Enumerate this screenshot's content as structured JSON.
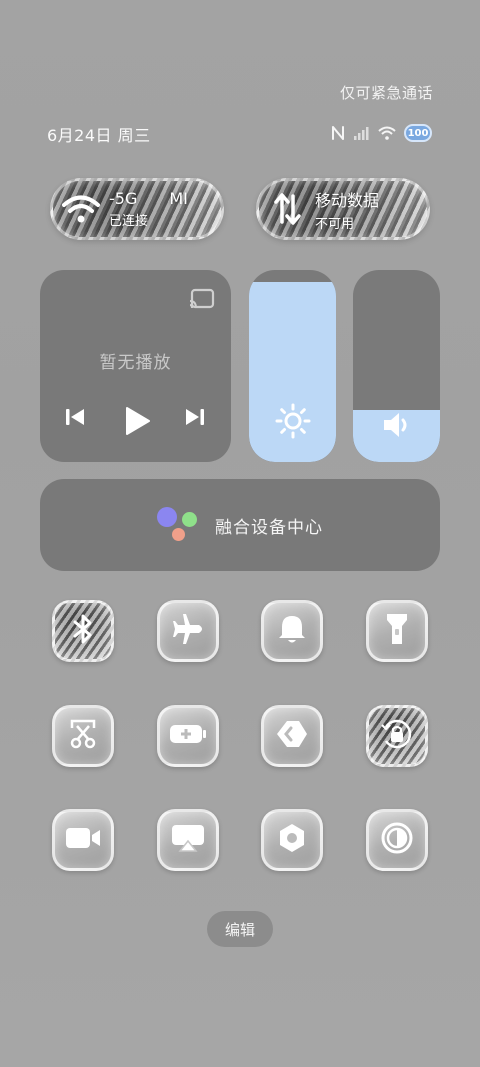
{
  "status": {
    "emergency": "仅可紧急通话",
    "date": "6月24日 周三",
    "battery": "100"
  },
  "wifi": {
    "name": "-5G",
    "extra": "MI",
    "sub": "已连接"
  },
  "mobile_data": {
    "title": "移动数据",
    "sub": "不可用"
  },
  "media": {
    "empty_label": "暂无播放"
  },
  "brightness": {
    "level": 0.94
  },
  "volume": {
    "level": 0.27
  },
  "fusion": {
    "label": "融合设备中心"
  },
  "tiles": [
    "bluetooth-icon",
    "airplane-icon",
    "bell-icon",
    "flashlight-icon",
    "screenshot-icon",
    "battery-saver-icon",
    "nearby-share-icon",
    "rotation-lock-icon",
    "video-icon",
    "screen-cast-icon",
    "settings-icon",
    "dark-mode-icon"
  ],
  "edit": {
    "label": "编辑"
  }
}
